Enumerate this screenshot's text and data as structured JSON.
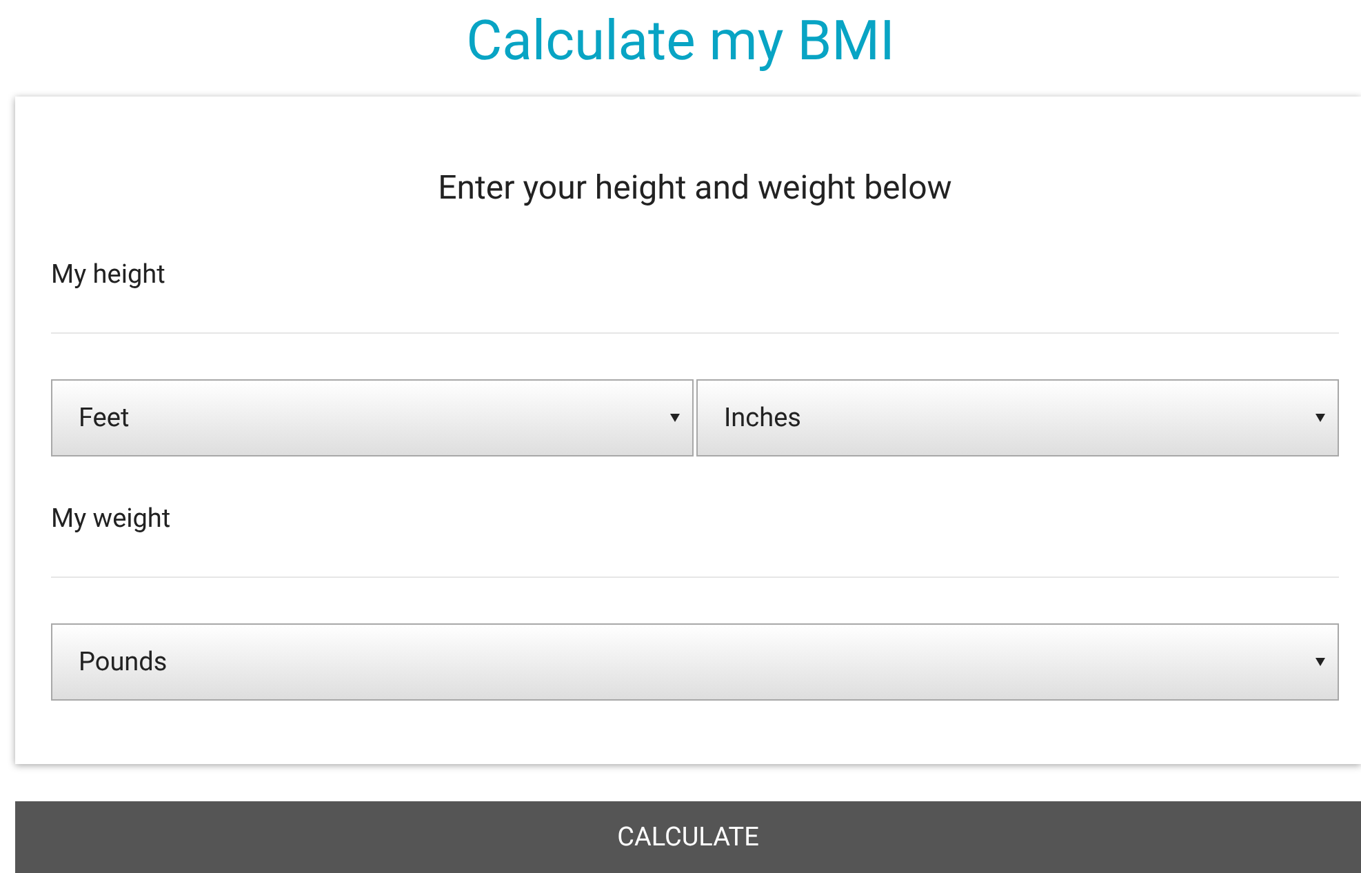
{
  "title": "Calculate my BMI",
  "card": {
    "heading": "Enter your height and weight below",
    "sections": [
      {
        "label": "My height",
        "selects": [
          {
            "value": "Feet"
          },
          {
            "value": "Inches"
          }
        ]
      },
      {
        "label": "My weight",
        "selects": [
          {
            "value": "Pounds"
          }
        ]
      }
    ]
  },
  "button": "CALCULATE"
}
